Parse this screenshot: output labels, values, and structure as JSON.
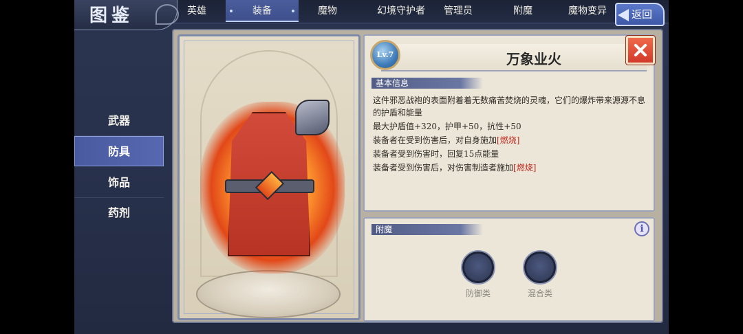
{
  "header": {
    "title": "图鉴",
    "tabs": [
      "英雄",
      "装备",
      "魔物",
      "幻境守护者",
      "管理员",
      "附魔",
      "魔物变异"
    ],
    "active_tab": "装备",
    "back_label": "返回"
  },
  "categories": {
    "items": [
      "武器",
      "防具",
      "饰品",
      "药剂"
    ],
    "active": "防具"
  },
  "item": {
    "level": "Lv.7",
    "name": "万象业火"
  },
  "basic_info": {
    "section_label": "基本信息",
    "description": "这件邪恶战袍的表面附着着无数痛苦焚烧的灵魂，它们的爆炸带来源源不息的护盾和能量",
    "stats": "最大护盾值+320，护甲+50，抗性+50",
    "effect1_text": "装备者在受到伤害后，对自身施加",
    "effect1_tag": "[燃烧]",
    "effect2_text": "装备者受到伤害时，回复15点能量",
    "effect3_text": "装备者受到伤害后，对伤害制造者施加",
    "effect3_tag": "[燃烧]"
  },
  "enchant": {
    "section_label": "附魔",
    "slots": [
      {
        "label": "防御类"
      },
      {
        "label": "混合类"
      }
    ]
  },
  "colors": {
    "active_tab": "#3e4f8c",
    "paper": "#ece6d9",
    "close_button": "#d23a2a",
    "burn_tag": "#c0281c"
  }
}
